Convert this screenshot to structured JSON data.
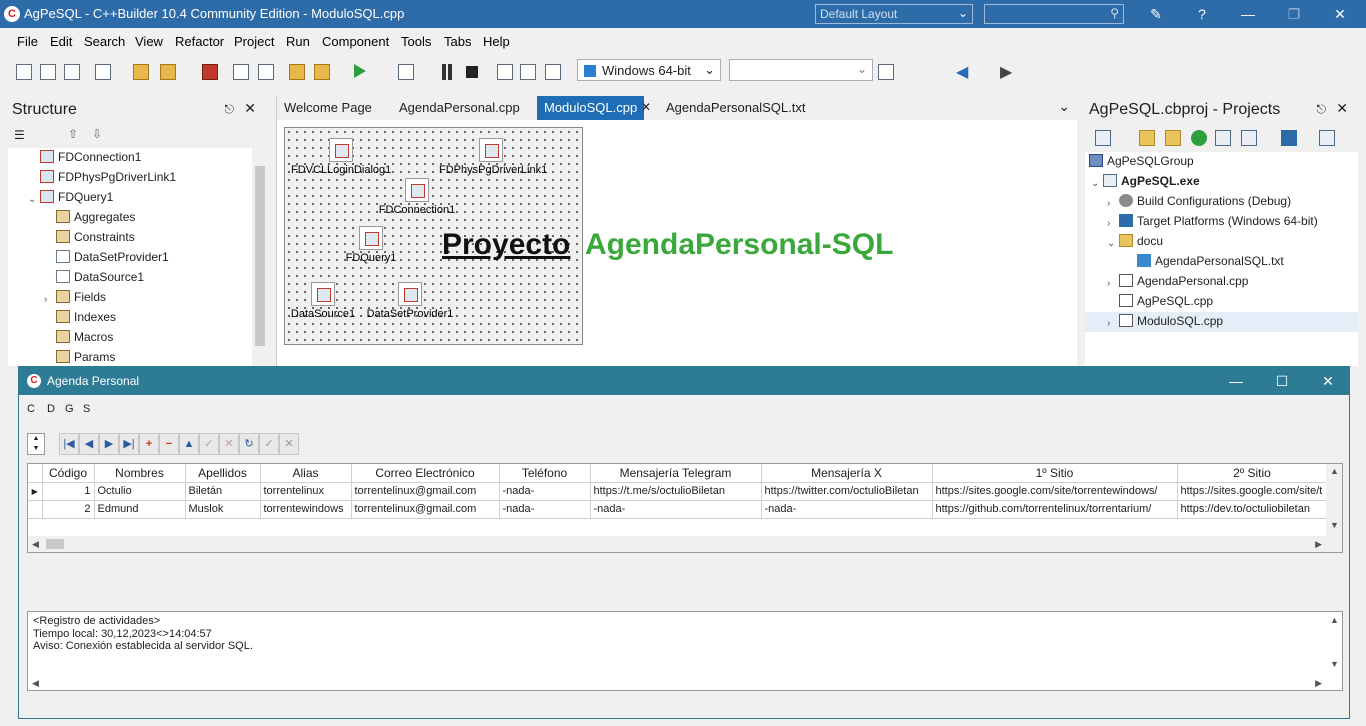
{
  "ide": {
    "title": "AgPeSQL - C++Builder 10.4 Community Edition - ModuloSQL.cpp",
    "logo": "C",
    "layout_select": "Default Layout",
    "window_controls": {
      "help": "?",
      "restore": "❐",
      "close": "✕"
    }
  },
  "menu": [
    "File",
    "Edit",
    "Search",
    "View",
    "Refactor",
    "Project",
    "Run",
    "Component",
    "Tools",
    "Tabs",
    "Help"
  ],
  "toolbar": {
    "platform": "Windows 64-bit",
    "config": ""
  },
  "structure": {
    "title": "Structure",
    "items": [
      {
        "label": "FDConnection1",
        "icon": "connection-icon"
      },
      {
        "label": "FDPhysPgDriverLink1",
        "icon": "driver-icon"
      },
      {
        "label": "FDQuery1",
        "icon": "query-icon"
      },
      {
        "label": "Aggregates",
        "icon": "collection-icon"
      },
      {
        "label": "Constraints",
        "icon": "collection-icon"
      },
      {
        "label": "DataSetProvider1",
        "icon": "provider-icon"
      },
      {
        "label": "DataSource1",
        "icon": "datasource-icon"
      },
      {
        "label": "Fields",
        "icon": "collection-icon"
      },
      {
        "label": "Indexes",
        "icon": "collection-icon"
      },
      {
        "label": "Macros",
        "icon": "collection-icon"
      },
      {
        "label": "Params",
        "icon": "collection-icon"
      }
    ]
  },
  "editor": {
    "tabs": [
      "Welcome Page",
      "AgendaPersonal.cpp",
      "ModuloSQL.cpp",
      "AgendaPersonalSQL.txt"
    ],
    "active_tab": "ModuloSQL.cpp",
    "components": [
      "FDVCLLoginDialog1",
      "FDPhysPgDriverLink1",
      "FDConnection1",
      "FDQuery1",
      "DataSource1",
      "DataSetProvider1"
    ],
    "label_word1": "Proyecto",
    "label_word2": "AgendaPersonal-SQL",
    "label_color": "#3aa83a"
  },
  "projects": {
    "title": "AgPeSQL.cbproj - Projects",
    "items": [
      {
        "label": "AgPeSQLGroup"
      },
      {
        "label": "AgPeSQL.exe"
      },
      {
        "label": "Build Configurations (Debug)"
      },
      {
        "label": "Target Platforms (Windows 64-bit)"
      },
      {
        "label": "docu"
      },
      {
        "label": "AgendaPersonalSQL.txt"
      },
      {
        "label": "AgendaPersonal.cpp"
      },
      {
        "label": "AgPeSQL.cpp"
      },
      {
        "label": "ModuloSQL.cpp"
      }
    ]
  },
  "app": {
    "title": "Agenda Personal",
    "logo": "C",
    "menu": [
      "C",
      "D",
      "G",
      "S"
    ],
    "grid": {
      "columns": [
        "Código",
        "Nombres",
        "Apellidos",
        "Alias",
        "Correo Electrónico",
        "Teléfono",
        "Mensajería Telegram",
        "Mensajería X",
        "1º Sitio",
        "2º Sitio"
      ],
      "rows": [
        [
          "1",
          "Octulio",
          "Biletán",
          "torrentelinux",
          "torrentelinux@gmail.com",
          "-nada-",
          "https://t.me/s/octulioBiletan",
          "https://twitter.com/octulioBiletan",
          "https://sites.google.com/site/torrentewindows/",
          "https://sites.google.com/site/t"
        ],
        [
          "2",
          "Edmund",
          "Muslok",
          "torrentewindows",
          "torrentelinux@gmail.com",
          "-nada-",
          "-nada-",
          "-nada-",
          "https://github.com/torrentelinux/torrentarium/",
          "https://dev.to/octuliobiletan"
        ]
      ]
    },
    "log": [
      "<Registro de actividades>",
      "Tiempo local: 30,12,2023<>14:04:57",
      "Aviso: Conexión establecida al servidor SQL."
    ]
  }
}
